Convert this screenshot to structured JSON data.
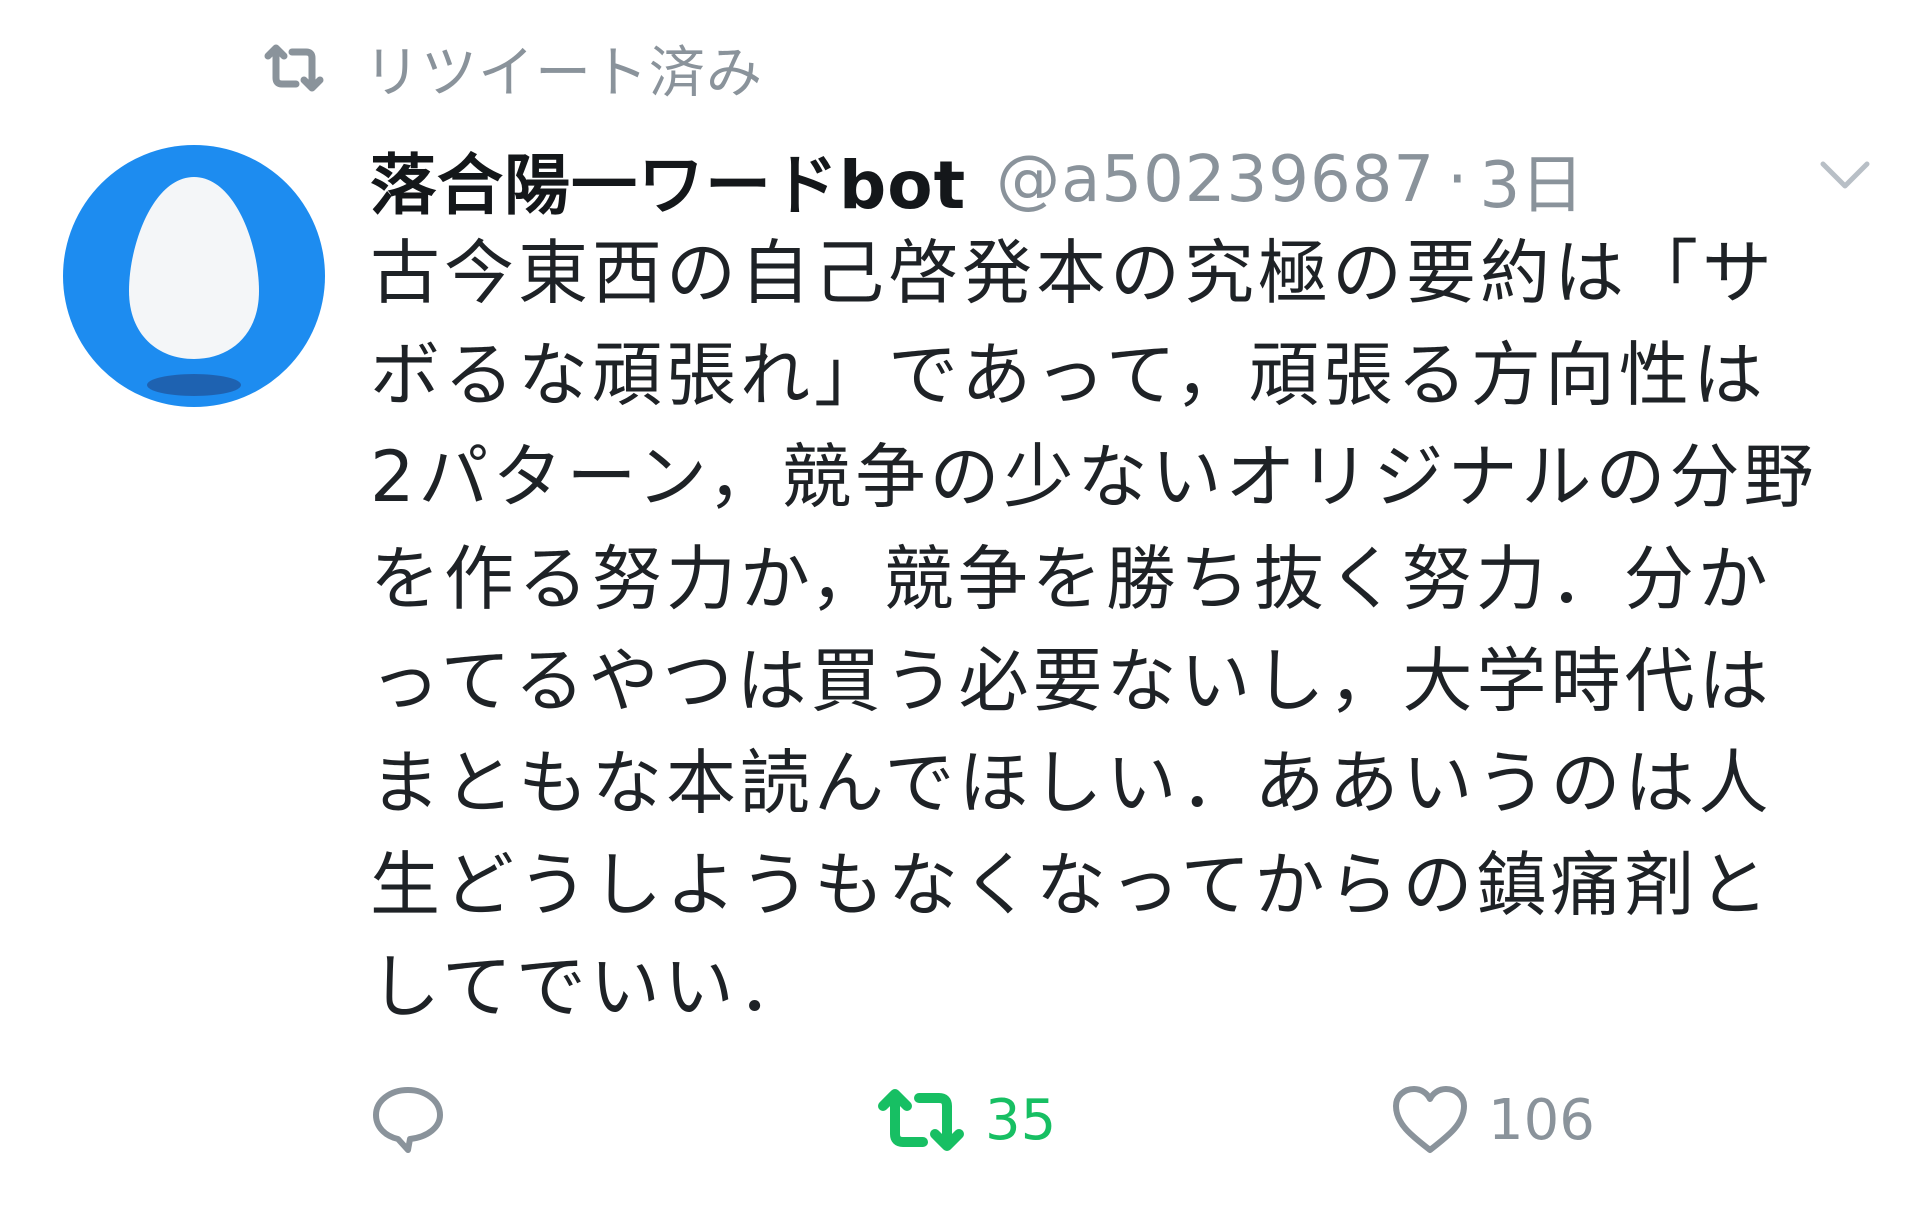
{
  "retweet_context": {
    "icon": "retweet-icon",
    "label": "リツイート済み"
  },
  "author": {
    "avatar": "default-egg-avatar",
    "display_name": "落合陽一ワードbot",
    "handle": "@a50239687",
    "separator": "·",
    "time": "3日"
  },
  "tweet": {
    "lines": [
      "古今東西の自己啓発本の究極の要約は「サ",
      "ボるな頑張れ」であって，頑張る方向性は",
      "2パターン，競争の少ないオリジナルの分野",
      "を作る努力か，競争を勝ち抜く努力．分か",
      "ってるやつは買う必要ないし，大学時代は",
      "まともな本読んでほしい．ああいうのは人",
      "生どうしようもなくなってからの鎮痛剤と",
      "してでいい．"
    ]
  },
  "actions": {
    "reply": {
      "icon": "reply-icon",
      "count": ""
    },
    "retweet": {
      "icon": "retweet-icon",
      "count": "35",
      "active": true,
      "color": "#17bf63"
    },
    "like": {
      "icon": "heart-icon",
      "count": "106"
    }
  },
  "menu": {
    "icon": "chevron-down-icon"
  },
  "colors": {
    "avatar_bg": "#1d8cf0",
    "secondary_text": "#8a939b",
    "retweet_active": "#17bf63"
  }
}
